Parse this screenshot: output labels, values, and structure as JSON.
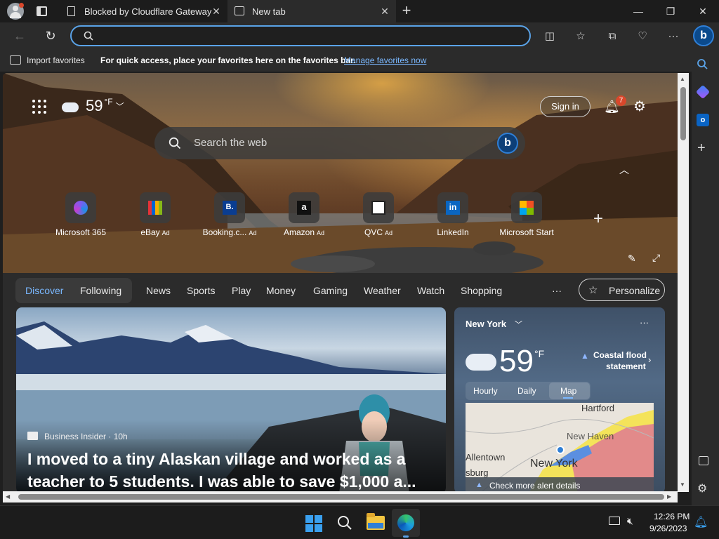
{
  "tabs": [
    {
      "title": "Blocked by Cloudflare Gateway",
      "active": false
    },
    {
      "title": "New tab",
      "active": true
    }
  ],
  "address": {
    "value": ""
  },
  "favorites": {
    "import_label": "Import favorites",
    "hint": "For quick access, place your favorites here on the favorites bar.",
    "manage_link": "Manage favorites now"
  },
  "hero": {
    "temperature": "59",
    "temperature_unit": "°F",
    "sign_in_label": "Sign in",
    "notification_count": "7",
    "search_placeholder": "Search the web",
    "quick_links": [
      {
        "label": "Microsoft 365",
        "ad": false,
        "icon": "microsoft-365-icon"
      },
      {
        "label": "eBay",
        "ad": true,
        "icon": "ebay-icon"
      },
      {
        "label": "Booking.c...",
        "ad": true,
        "icon": "booking-icon"
      },
      {
        "label": "Amazon",
        "ad": true,
        "icon": "amazon-icon"
      },
      {
        "label": "QVC",
        "ad": true,
        "icon": "qvc-icon"
      },
      {
        "label": "LinkedIn",
        "ad": false,
        "icon": "linkedin-icon"
      },
      {
        "label": "Microsoft Start",
        "ad": false,
        "icon": "microsoft-start-icon"
      }
    ],
    "ad_label": "Ad"
  },
  "news_nav": {
    "discover": "Discover",
    "following": "Following",
    "items": [
      "News",
      "Sports",
      "Play",
      "Money",
      "Gaming",
      "Weather",
      "Watch",
      "Shopping"
    ],
    "more": "···",
    "personalize": "Personalize"
  },
  "main_story": {
    "source": "Business Insider · 10h",
    "headline": "I moved to a tiny Alaskan village and worked as a teacher to 5 students. I was able to save $1,000 a..."
  },
  "weather_card": {
    "location": "New York",
    "temperature": "59",
    "unit": "°F",
    "alert_title": "Coastal flood",
    "alert_sub": "statement",
    "tabs": [
      "Hourly",
      "Daily",
      "Map"
    ],
    "active_tab": "Map",
    "map_labels": [
      "Hartford",
      "New Haven",
      "Allentown",
      "New York",
      "sburg"
    ],
    "alert_link": "Check more alert details"
  },
  "taskbar": {
    "time": "12:26 PM",
    "date": "9/26/2023"
  },
  "colors": {
    "accent": "#5aa3e8",
    "link": "#7ab8ff",
    "badge": "#d9472b"
  }
}
